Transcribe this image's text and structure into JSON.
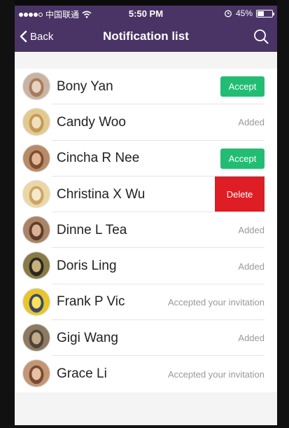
{
  "status_bar": {
    "carrier": "中国联通",
    "time": "5:50 PM",
    "battery_text": "45%",
    "battery_level": 0.45
  },
  "nav": {
    "back_label": "Back",
    "title": "Notification list"
  },
  "contacts": [
    {
      "name": "Bony Yan",
      "action": "Accept",
      "status": ""
    },
    {
      "name": "Candy Woo",
      "action": "",
      "status": "Added"
    },
    {
      "name": "Cincha R Nee",
      "action": "Accept",
      "status": ""
    },
    {
      "name": "Christina X Wu",
      "action": "Delete",
      "status": ""
    },
    {
      "name": "Dinne L Tea",
      "action": "",
      "status": "Added"
    },
    {
      "name": "Doris Ling",
      "action": "",
      "status": "Added"
    },
    {
      "name": "Frank P Vic",
      "action": "",
      "status": "Accepted your invitation"
    },
    {
      "name": "Gigi Wang",
      "action": "",
      "status": "Added"
    },
    {
      "name": "Grace Li",
      "action": "",
      "status": "Accepted your invitation"
    }
  ],
  "colors": {
    "nav_bg": "#4a3465",
    "accept_green": "#22bd73",
    "delete_red": "#de1d24"
  }
}
